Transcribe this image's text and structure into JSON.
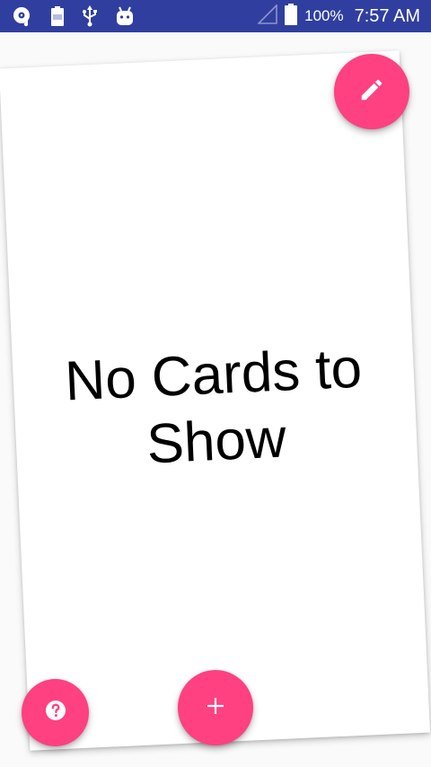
{
  "status_bar": {
    "battery_percent": "100%",
    "time": "7:57 AM",
    "icons": [
      "music-disc-icon",
      "battery-saver-icon",
      "usb-icon",
      "android-icon",
      "signal-icon",
      "battery-icon"
    ]
  },
  "card": {
    "empty_message": "No Cards to Show"
  },
  "fabs": {
    "edit_icon": "pencil-icon",
    "add_icon": "plus-icon",
    "help_icon": "question-icon"
  },
  "colors": {
    "status_bar": "#303f9f",
    "accent": "#ff4081",
    "background": "#fafafa"
  }
}
